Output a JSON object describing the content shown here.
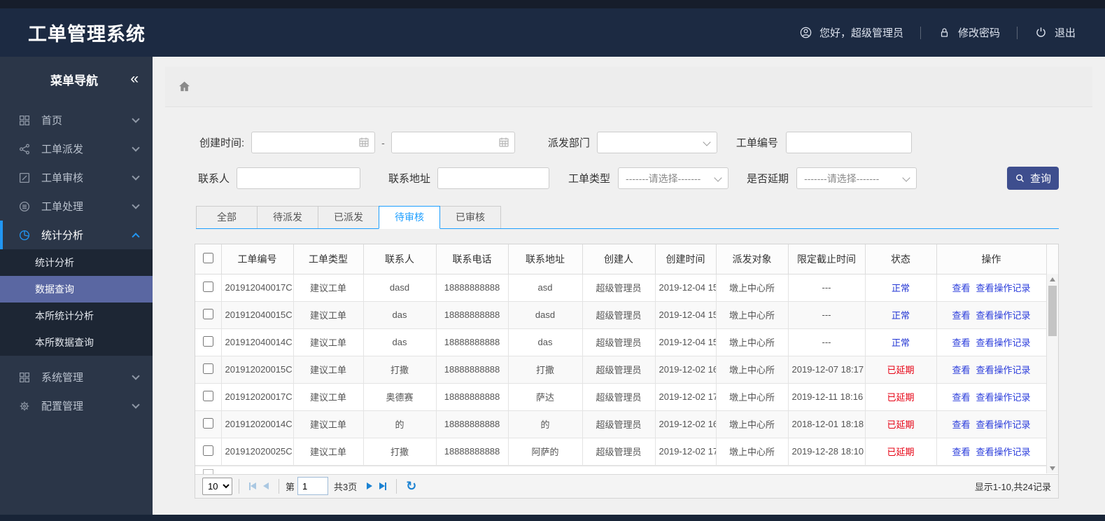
{
  "topbar": {
    "title": "工单管理系统",
    "greeting": "您好，超级管理员",
    "change_password": "修改密码",
    "logout": "退出"
  },
  "sidebar": {
    "title": "菜单导航",
    "collapse_glyph": "«",
    "menu": [
      {
        "label": "首页"
      },
      {
        "label": "工单派发"
      },
      {
        "label": "工单审核"
      },
      {
        "label": "工单处理"
      },
      {
        "label": "统计分析"
      }
    ],
    "submenu": [
      {
        "label": "统计分析"
      },
      {
        "label": "数据查询"
      },
      {
        "label": "本所统计分析"
      },
      {
        "label": "本所数据查询"
      }
    ],
    "menu_bottom": [
      {
        "label": "系统管理"
      },
      {
        "label": "配置管理"
      }
    ]
  },
  "filters": {
    "create_time_label": "创建时间:",
    "range_separator": "-",
    "start_date": "",
    "end_date": "",
    "dispatch_dept_label": "派发部门",
    "order_no_label": "工单编号",
    "order_no_value": "",
    "contact_label": "联系人",
    "contact_value": "",
    "address_label": "联系地址",
    "address_value": "",
    "order_type_label": "工单类型",
    "delay_label": "是否延期",
    "select_placeholder": "-------请选择-------",
    "search_button": "查询"
  },
  "tabs": [
    {
      "label": "全部"
    },
    {
      "label": "待派发"
    },
    {
      "label": "已派发"
    },
    {
      "label": "待审核"
    },
    {
      "label": "已审核"
    }
  ],
  "table": {
    "headers": [
      "工单编号",
      "工单类型",
      "联系人",
      "联系电话",
      "联系地址",
      "创建人",
      "创建时间",
      "派发对象",
      "限定截止时间",
      "状态",
      "操作"
    ],
    "actions": {
      "view": "查看",
      "view_log": "查看操作记录"
    },
    "rows": [
      {
        "order_no": "201912040017C",
        "order_type": "建议工单",
        "contact": "dasd",
        "phone": "18888888888",
        "address": "asd",
        "creator": "超级管理员",
        "created": "2019-12-04 15",
        "target": "墩上中心所",
        "deadline": "---",
        "status": "正常"
      },
      {
        "order_no": "201912040015C",
        "order_type": "建议工单",
        "contact": "das",
        "phone": "18888888888",
        "address": "dasd",
        "creator": "超级管理员",
        "created": "2019-12-04 15",
        "target": "墩上中心所",
        "deadline": "---",
        "status": "正常"
      },
      {
        "order_no": "201912040014C",
        "order_type": "建议工单",
        "contact": "das",
        "phone": "18888888888",
        "address": "das",
        "creator": "超级管理员",
        "created": "2019-12-04 15",
        "target": "墩上中心所",
        "deadline": "---",
        "status": "正常"
      },
      {
        "order_no": "201912020015C",
        "order_type": "建议工单",
        "contact": "打撒",
        "phone": "18888888888",
        "address": "打撒",
        "creator": "超级管理员",
        "created": "2019-12-02 16",
        "target": "墩上中心所",
        "deadline": "2019-12-07 18:17",
        "status": "已延期"
      },
      {
        "order_no": "201912020017C",
        "order_type": "建议工单",
        "contact": "奥德赛",
        "phone": "18888888888",
        "address": "萨达",
        "creator": "超级管理员",
        "created": "2019-12-02 17",
        "target": "墩上中心所",
        "deadline": "2019-12-11 18:16",
        "status": "已延期"
      },
      {
        "order_no": "201912020014C",
        "order_type": "建议工单",
        "contact": "的",
        "phone": "18888888888",
        "address": "的",
        "creator": "超级管理员",
        "created": "2019-12-02 16",
        "target": "墩上中心所",
        "deadline": "2018-12-01 18:18",
        "status": "已延期"
      },
      {
        "order_no": "201912020025C",
        "order_type": "建议工单",
        "contact": "打撒",
        "phone": "18888888888",
        "address": "阿萨的",
        "creator": "超级管理员",
        "created": "2019-12-02 17",
        "target": "墩上中心所",
        "deadline": "2019-12-28 18:10",
        "status": "已延期"
      }
    ]
  },
  "pagination": {
    "page_size": "10",
    "page_prefix": "第",
    "page_value": "1",
    "total_pages": "共3页",
    "refresh_glyph": "↻",
    "summary": "显示1-10,共24记录"
  },
  "colors": {
    "navy": "#1c2a42",
    "accent_blue": "#1e9fff",
    "button_indigo": "#3e4e8e",
    "link_blue": "#2a3cdb",
    "status_normal": "#2336d4",
    "status_delayed": "#e60012",
    "submenu_selected": "#5a67a2"
  }
}
